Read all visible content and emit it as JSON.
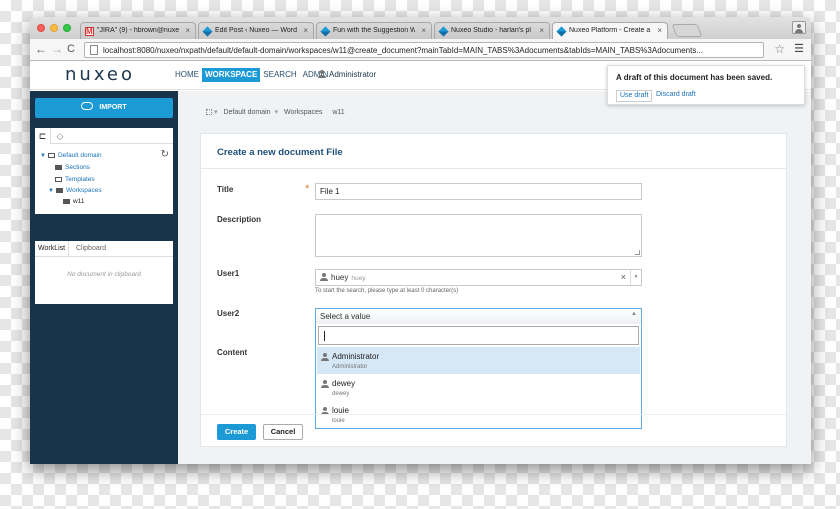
{
  "browser": {
    "tabs": [
      {
        "title": "\"JIRA\" (9) - hbrown@nuxe",
        "icon": "gmail-icon"
      },
      {
        "title": "Edit Post ‹ Nuxeo — Word",
        "icon": "nuxeo-icon"
      },
      {
        "title": "Fun with the Suggestion W",
        "icon": "nuxeo-icon"
      },
      {
        "title": "Nuxeo Studio - harlan's pl",
        "icon": "nuxeo-icon"
      },
      {
        "title": "Nuxeo Platform - Create a",
        "icon": "nuxeo-icon"
      }
    ],
    "close_glyph": "×",
    "url": "localhost:8080/nuxeo/nxpath/default/default-domain/workspaces/w11@create_document?mainTabId=MAIN_TABS%3Adocuments&tabIds=MAIN_TABS%3Adocuments..."
  },
  "header": {
    "logo": "nuxeo",
    "nav": [
      "HOME",
      "WORKSPACE",
      "SEARCH",
      "ADMIN"
    ],
    "active_nav": "WORKSPACE",
    "user": "Administrator"
  },
  "sidebar": {
    "import_label": "IMPORT",
    "tree": {
      "root": "Default domain",
      "items": [
        "Sections",
        "Templates",
        "Workspaces",
        "w11"
      ]
    },
    "worklist": {
      "tabs": [
        "WorkList",
        "Clipboard"
      ],
      "empty": "No document in clipboard"
    }
  },
  "breadcrumb": [
    "Default domain",
    "Workspaces",
    "w11"
  ],
  "form": {
    "title": "Create a new document File",
    "labels": {
      "title": "Title",
      "description": "Description",
      "user1": "User1",
      "user2": "User2",
      "content": "Content"
    },
    "title_value": "File 1",
    "user1": {
      "name": "huey",
      "id": "huey"
    },
    "user1_hint": "To start the search, please type at least 0 character(s)",
    "user2_placeholder": "Select a value",
    "dropdown": [
      {
        "name": "Administrator",
        "id": "Administrator",
        "highlighted": true
      },
      {
        "name": "dewey",
        "id": "dewey",
        "highlighted": false
      },
      {
        "name": "louie",
        "id": "louie",
        "highlighted": false
      }
    ],
    "create_label": "Create",
    "cancel_label": "Cancel"
  },
  "notice": {
    "message": "A draft of this document has been saved.",
    "use_draft": "Use draft",
    "discard_draft": "Discard draft"
  },
  "colors": {
    "accent": "#1b9ad6",
    "sidebar": "#18344a",
    "highlight": "#d6e7f6"
  }
}
